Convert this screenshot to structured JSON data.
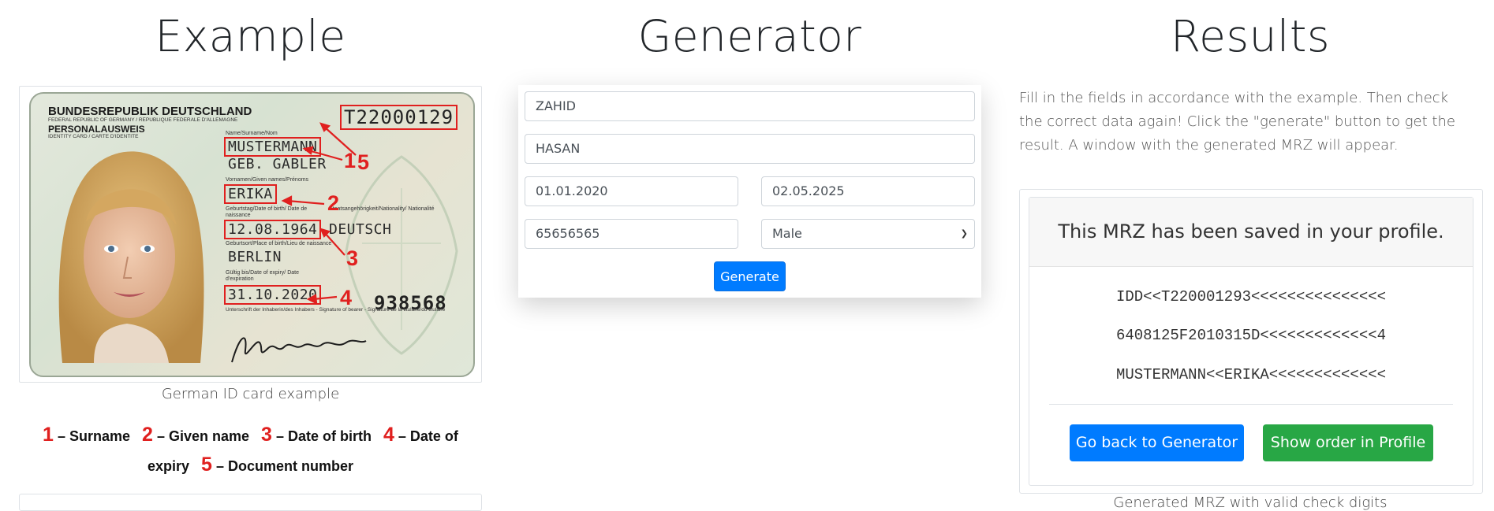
{
  "columns": {
    "example_title": "Example",
    "generator_title": "Generator",
    "results_title": "Results"
  },
  "example": {
    "card": {
      "header_country": "BUNDESREPUBLIK DEUTSCHLAND",
      "header_country_sub": "FEDERAL REPUBLIC OF GERMANY / REPUBLIQUE FEDERALE D'ALLEMAGNE",
      "header_doc": "PERSONALAUSWEIS",
      "header_doc_sub": "IDENTITY CARD / CARTE D'IDENTITE",
      "doc_number": "T22000129",
      "surname_label": "Name/Surname/Nom",
      "surname": "MUSTERMANN",
      "birth_name": "GEB. GABLER",
      "given_label": "Vornamen/Given names/Prénoms",
      "given_name": "ERIKA",
      "dob_label": "Geburtstag/Date of birth/ Date de naissance",
      "nationality_label": "Staatsangehörigkeit/Nationality/ Nationalité",
      "dob": "12.08.1964",
      "nationality": "DEUTSCH",
      "pob_label": "Geburtsort/Place of birth/Lieu de naissance",
      "pob": "BERLIN",
      "expiry_label": "Gültig bis/Date of expiry/ Date d'expiration",
      "expiry": "31.10.2020",
      "card_access_number": "938568",
      "signature_label": "Unterschrift der Inhaberin/des Inhabers - Signature of bearer - Signature de la titulaire/du titulaire",
      "marker_1": "1",
      "marker_2": "2",
      "marker_3": "3",
      "marker_4": "4",
      "marker_5": "5"
    },
    "caption": "German ID card example",
    "legend": [
      {
        "num": "1",
        "text": "– Surname"
      },
      {
        "num": "2",
        "text": "– Given name"
      },
      {
        "num": "3",
        "text": "– Date of birth"
      },
      {
        "num": "4",
        "text": "– Date of expiry"
      },
      {
        "num": "5",
        "text": "– Document number"
      }
    ]
  },
  "generator": {
    "surname_value": "ZAHID",
    "given_value": "HASAN",
    "dob_value": "01.01.2020",
    "expiry_value": "02.05.2025",
    "doc_number_value": "65656565",
    "sex_value": "Male",
    "generate_label": "Generate"
  },
  "results": {
    "description": "Fill in the fields in accordance with the example. Then check the correct data again! Click the \"generate\" button to get the result. A window with the generated MRZ will appear.",
    "saved_message": "This MRZ has been saved in your profile.",
    "mrz_line1": "IDD<<T220001293<<<<<<<<<<<<<<<",
    "mrz_line2": "6408125F2010315D<<<<<<<<<<<<<4",
    "mrz_line3": "MUSTERMANN<<ERIKA<<<<<<<<<<<<<",
    "back_button": "Go back to Generator",
    "order_button": "Show order in Profile",
    "footer_caption": "Generated MRZ with valid check digits"
  }
}
